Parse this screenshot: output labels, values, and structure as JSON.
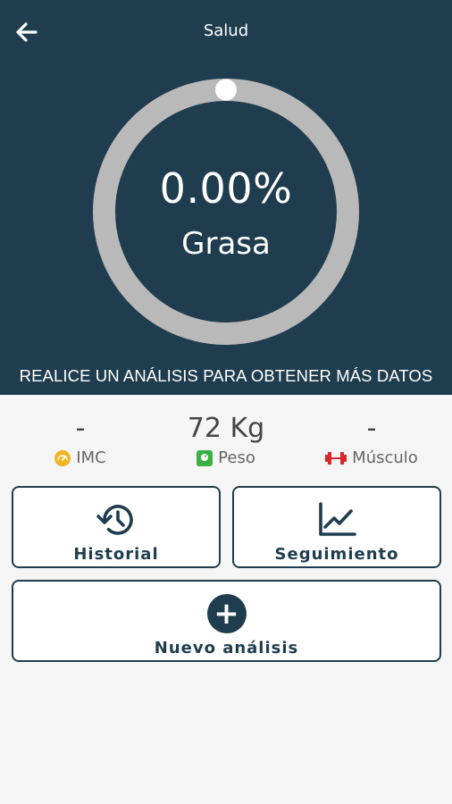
{
  "app": {
    "title": "Salud"
  },
  "body_fat": {
    "value": "0.00%",
    "label": "Grasa"
  },
  "banner": "REALICE UN ANÁLISIS PARA OBTENER MÁS DATOS",
  "stats": [
    {
      "value": "-",
      "label": "IMC",
      "icon": "gauge-icon",
      "color": "#f0b323"
    },
    {
      "value": "72 Kg",
      "label": "Peso",
      "icon": "scale-icon",
      "color": "#3cb043"
    },
    {
      "value": "-",
      "label": "Músculo",
      "icon": "dumbbell-icon",
      "color": "#d9262c"
    }
  ],
  "actions": {
    "historial": "Historial",
    "seguimiento": "Seguimiento",
    "nuevo": "Nuevo análisis"
  },
  "colors": {
    "primary": "#1f3d4e",
    "ring": "#b9b9b9",
    "background": "#f5f5f5"
  }
}
